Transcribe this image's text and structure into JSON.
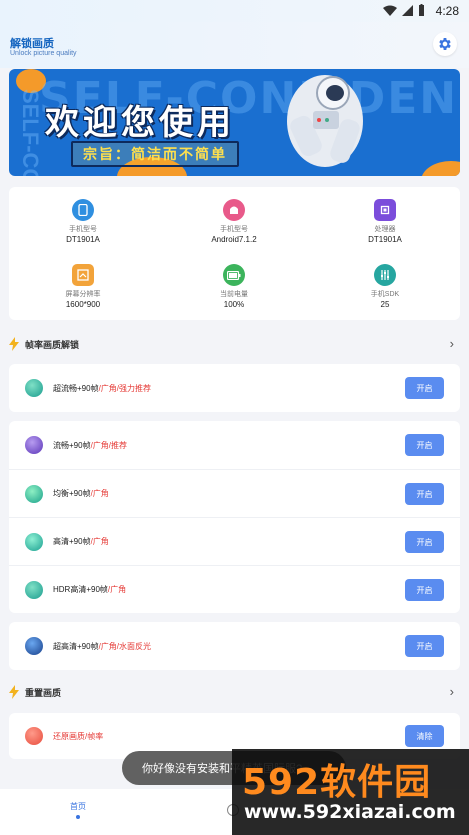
{
  "status_bar": {
    "time": "4:28"
  },
  "header": {
    "title": "解锁画质",
    "subtitle": "Unlock picture quality"
  },
  "banner": {
    "title": "欢迎您使用",
    "slogan": "宗旨：简洁而不简单",
    "bg_text": "SELF-CONFIDEN",
    "side_text": "SELF-CONF"
  },
  "device_info": [
    {
      "label": "手机型号",
      "value": "DT1901A",
      "color": "#2f8fe0",
      "icon": "phone-icon"
    },
    {
      "label": "手机型号",
      "value": "Android7.1.2",
      "color": "#e85a8a",
      "icon": "android-icon"
    },
    {
      "label": "处理器",
      "value": "DT1901A",
      "color": "#7b4ddb",
      "icon": "chip-icon"
    },
    {
      "label": "屏幕分辨率",
      "value": "1600*900",
      "color": "#f2a33a",
      "icon": "screen-icon"
    },
    {
      "label": "当前电量",
      "value": "100%",
      "color": "#3cb45c",
      "icon": "battery-icon"
    },
    {
      "label": "手机SDK",
      "value": "25",
      "color": "#26a6a0",
      "icon": "sliders-icon"
    }
  ],
  "frame_section": {
    "title": "帧率画质解锁"
  },
  "frame_options": [
    {
      "name": "超流畅+90帧",
      "tag": "/广角/强力推荐",
      "button": "开启",
      "color": "#1a9c8e"
    },
    {
      "name": "流畅+90帧",
      "tag": "/广角/推荐",
      "button": "开启",
      "color": "#5b35b8"
    },
    {
      "name": "均衡+90帧",
      "tag": "/广角",
      "button": "开启",
      "color": "#19a08a"
    },
    {
      "name": "高清+90帧",
      "tag": "/广角",
      "button": "开启",
      "color": "#1a9f90"
    },
    {
      "name": "HDR高清+90帧",
      "tag": "/广角",
      "button": "开启",
      "color": "#1a9c8e"
    },
    {
      "name": "超高清+90帧",
      "tag": "/广角/水面反光",
      "button": "开启",
      "color": "#173f8a"
    }
  ],
  "reset_section": {
    "title": "重置画质"
  },
  "reset_option": {
    "name": "还原画质/帧率",
    "button": "清除",
    "color": "#e74c3c"
  },
  "toast": {
    "text": "你好像没有安装和平精英国际服?"
  },
  "watermark": {
    "logo": "592软件园",
    "url": "www.592xiazai.com"
  },
  "bottom_nav": {
    "home": "首页"
  },
  "colors": {
    "accent": "#5a8cf0",
    "tag_red": "#e53935",
    "brand_blue": "#1565c0"
  }
}
